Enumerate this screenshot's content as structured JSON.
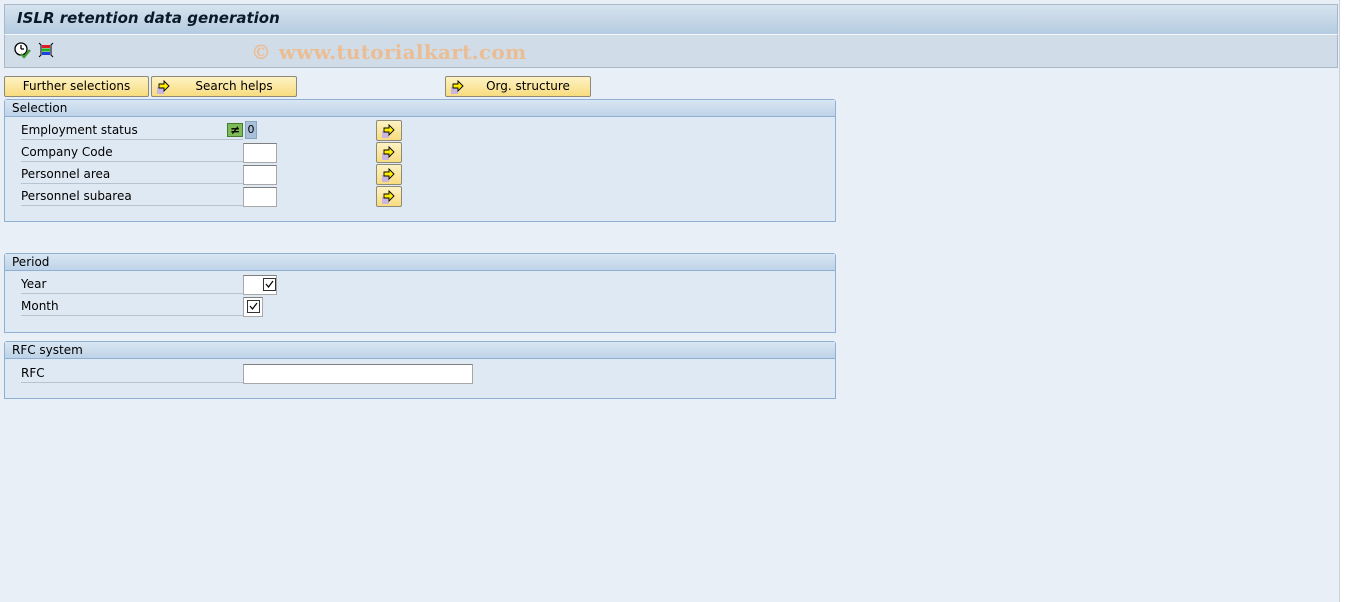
{
  "window": {
    "title": "ISLR retention data generation",
    "watermark": "© www.tutorialkart.com"
  },
  "toolbar": {
    "icons": [
      {
        "name": "execute-clock-icon",
        "tooltip": ""
      },
      {
        "name": "selection-options-icon",
        "tooltip": ""
      }
    ]
  },
  "buttons": {
    "further_selections": "Further selections",
    "search_helps": "Search helps",
    "org_structure": "Org. structure"
  },
  "selection": {
    "title": "Selection",
    "rows": [
      {
        "label": "Employment status",
        "operator_icon": "not-equal",
        "value": "0"
      },
      {
        "label": "Company Code",
        "value": ""
      },
      {
        "label": "Personnel area",
        "value": ""
      },
      {
        "label": "Personnel subarea",
        "value": ""
      }
    ]
  },
  "period": {
    "title": "Period",
    "rows": [
      {
        "label": "Year",
        "value": "",
        "required": true
      },
      {
        "label": "Month",
        "value": "",
        "required": true
      }
    ]
  },
  "rfc": {
    "title": "RFC system",
    "rows": [
      {
        "label": "RFC",
        "value": ""
      }
    ]
  },
  "colors": {
    "background": "#e8eff7",
    "group_border": "#8fb0d0",
    "button_yellow": "#f8dc7e",
    "status_green": "#7cbb55"
  }
}
